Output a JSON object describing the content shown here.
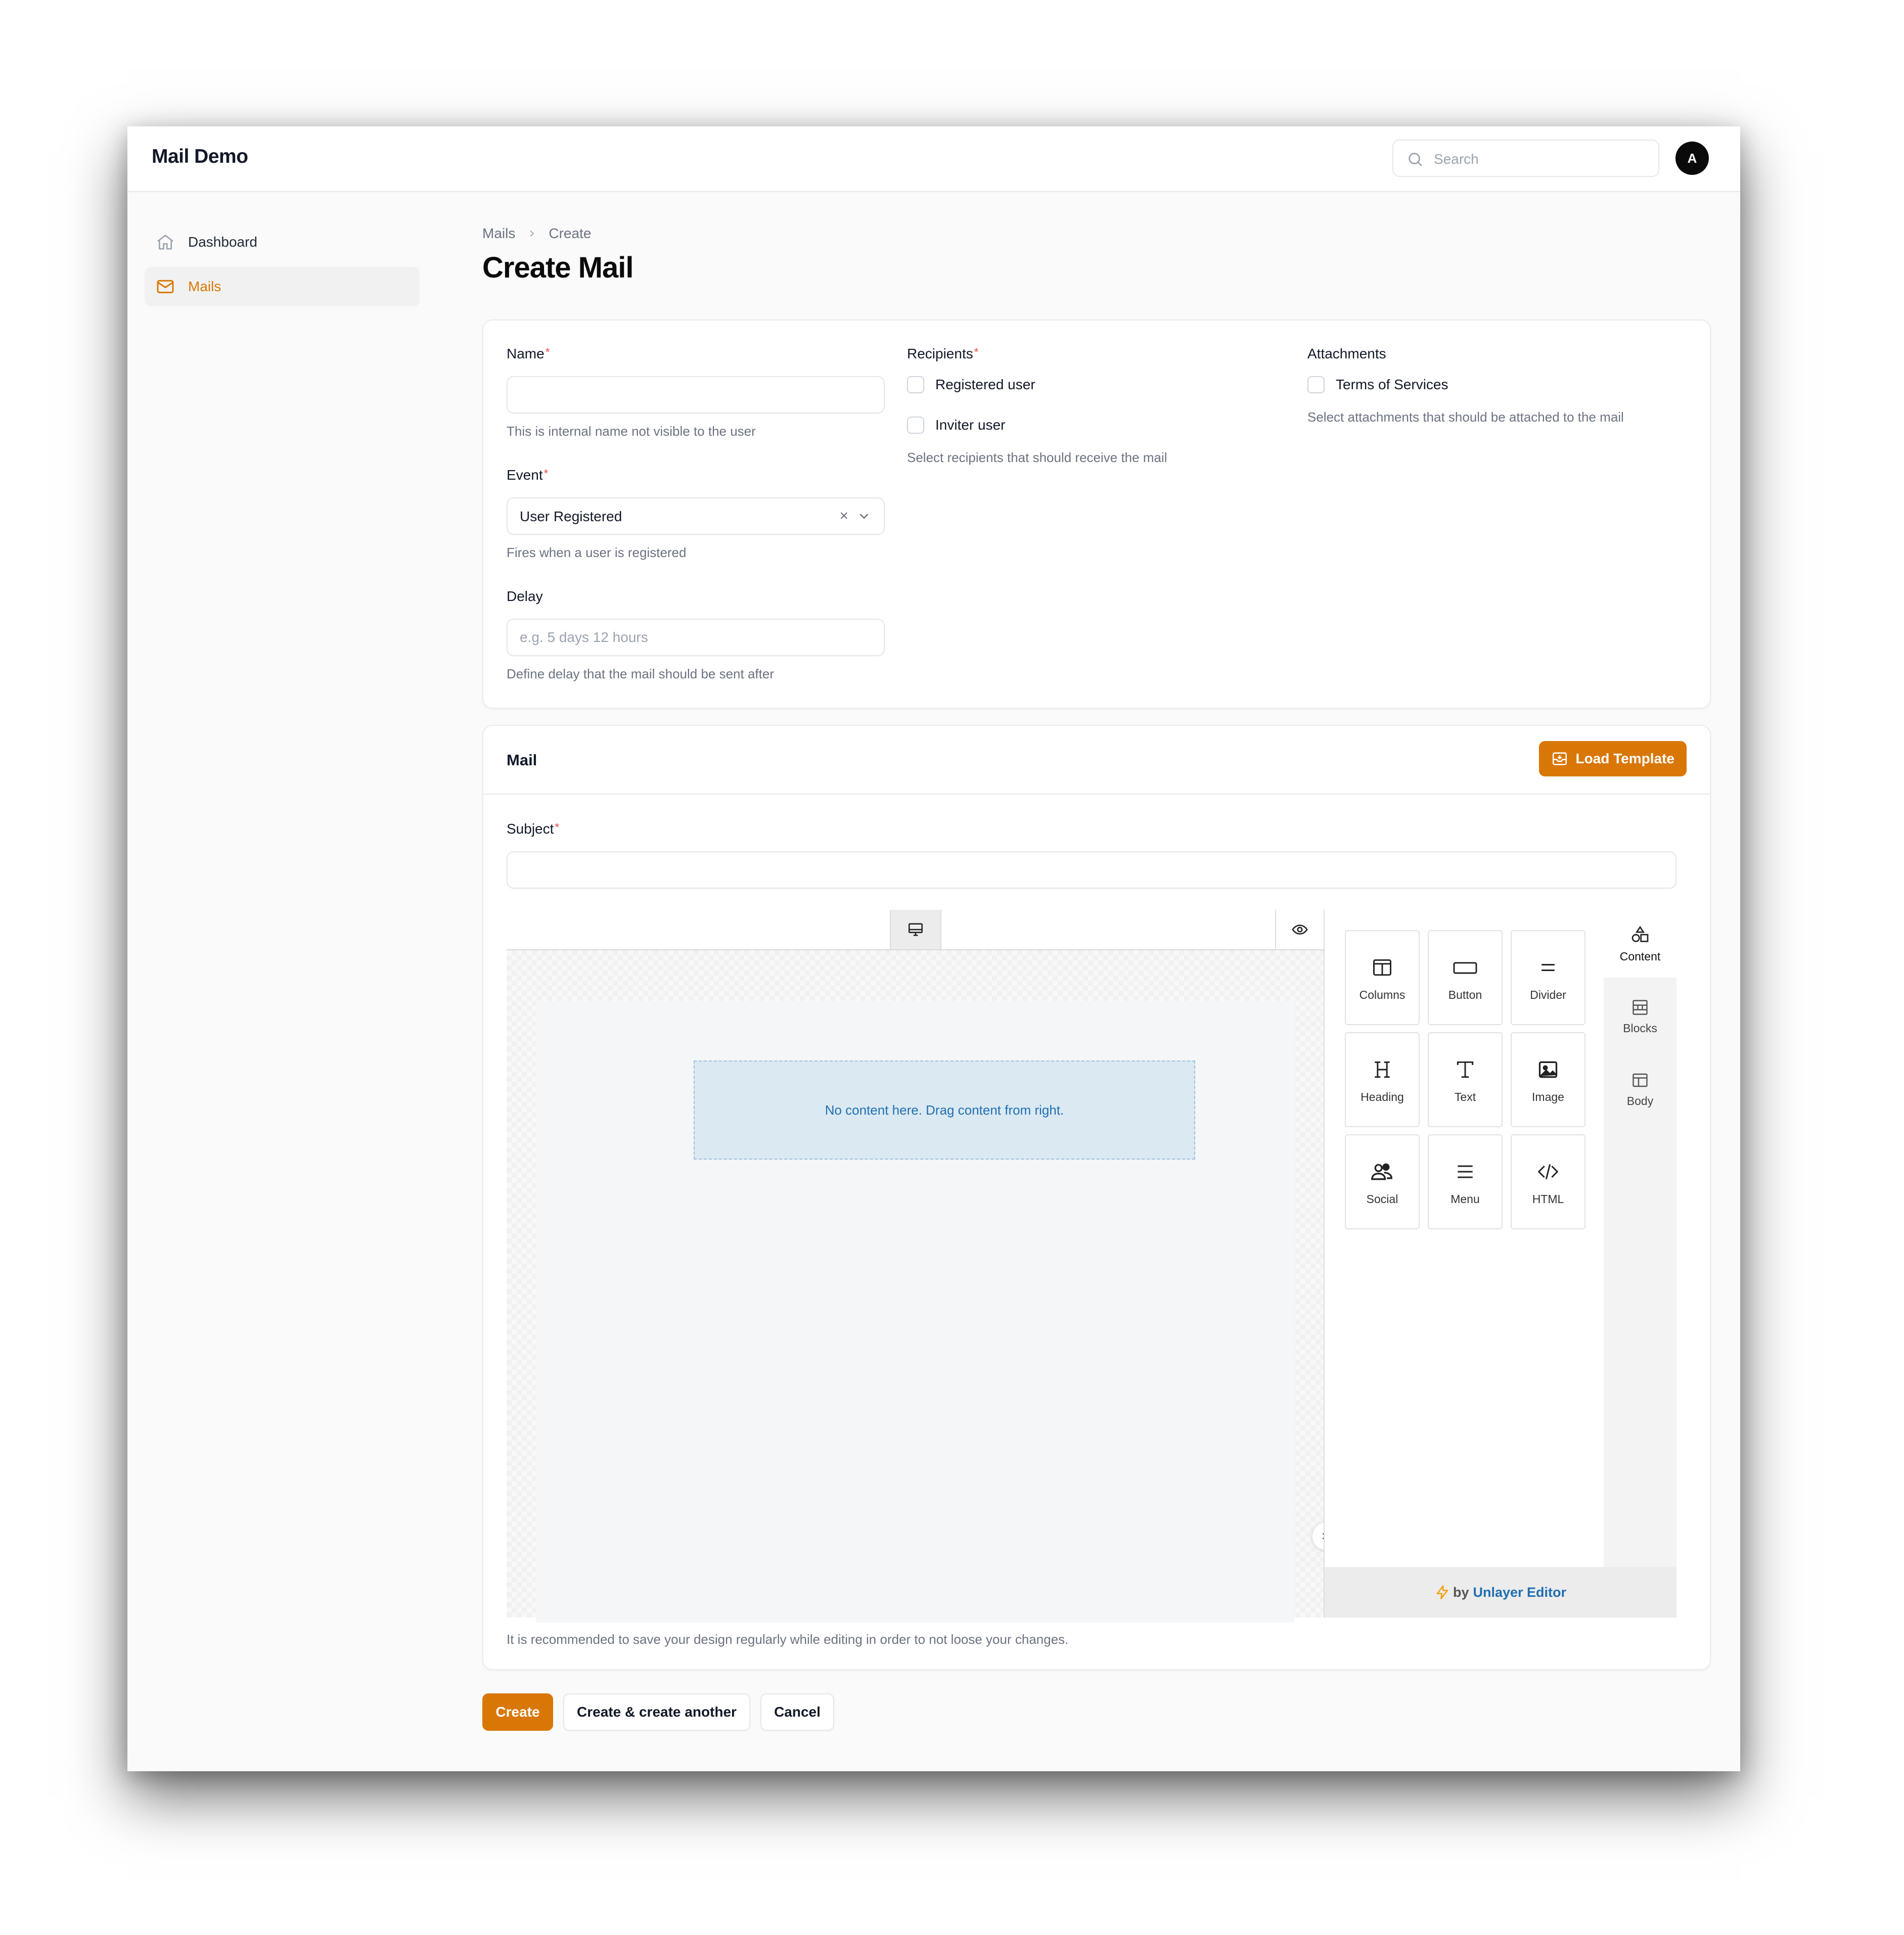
{
  "app": {
    "title": "Mail Demo"
  },
  "search": {
    "placeholder": "Search",
    "icon": "search-icon"
  },
  "user": {
    "avatar_initial": "A"
  },
  "sidebar": {
    "items": [
      {
        "label": "Dashboard",
        "icon": "home-icon",
        "active": false
      },
      {
        "label": "Mails",
        "icon": "mail-icon",
        "active": true
      }
    ]
  },
  "breadcrumb": {
    "items": [
      "Mails",
      "Create"
    ]
  },
  "page": {
    "title": "Create Mail"
  },
  "form": {
    "name": {
      "label": "Name",
      "required_mark": "*",
      "value": "",
      "helper": "This is internal name not visible to the user"
    },
    "event": {
      "label": "Event",
      "required_mark": "*",
      "value": "User Registered",
      "clear_glyph": "×",
      "helper": "Fires when a user is registered"
    },
    "delay": {
      "label": "Delay",
      "placeholder": "e.g. 5 days 12 hours",
      "value": "",
      "helper": "Define delay that the mail should be sent after"
    },
    "recipients": {
      "label": "Recipients",
      "required_mark": "*",
      "options": [
        {
          "label": "Registered user",
          "checked": false
        },
        {
          "label": "Inviter user",
          "checked": false
        }
      ],
      "helper": "Select recipients that should receive the mail"
    },
    "attachments": {
      "label": "Attachments",
      "options": [
        {
          "label": "Terms of Services",
          "checked": false
        }
      ],
      "helper": "Select attachments that should be attached to the mail"
    }
  },
  "mail_section": {
    "title": "Mail",
    "load_template_label": "Load Template",
    "subject": {
      "label": "Subject",
      "required_mark": "*",
      "value": ""
    },
    "editor": {
      "empty_message": "No content here. Drag content from right.",
      "tiles": [
        {
          "label": "Columns",
          "icon": "columns-icon"
        },
        {
          "label": "Button",
          "icon": "button-icon"
        },
        {
          "label": "Divider",
          "icon": "divider-icon"
        },
        {
          "label": "Heading",
          "icon": "heading-icon"
        },
        {
          "label": "Text",
          "icon": "text-icon"
        },
        {
          "label": "Image",
          "icon": "image-icon"
        },
        {
          "label": "Social",
          "icon": "social-icon"
        },
        {
          "label": "Menu",
          "icon": "menu-icon"
        },
        {
          "label": "HTML",
          "icon": "html-icon"
        }
      ],
      "tabs": [
        {
          "label": "Content",
          "icon": "shapes-icon",
          "active": true
        },
        {
          "label": "Blocks",
          "icon": "blocks-icon",
          "active": false
        },
        {
          "label": "Body",
          "icon": "body-icon",
          "active": false
        }
      ],
      "footer": {
        "by": "by",
        "brand": "Unlayer Editor"
      }
    },
    "save_note": "It is recommended to save your design regularly while editing in order to not loose your changes."
  },
  "actions": {
    "create": "Create",
    "create_another": "Create & create another",
    "cancel": "Cancel"
  },
  "colors": {
    "accent": "#d97706",
    "link": "#1f6fb2",
    "required": "#ef4444"
  }
}
